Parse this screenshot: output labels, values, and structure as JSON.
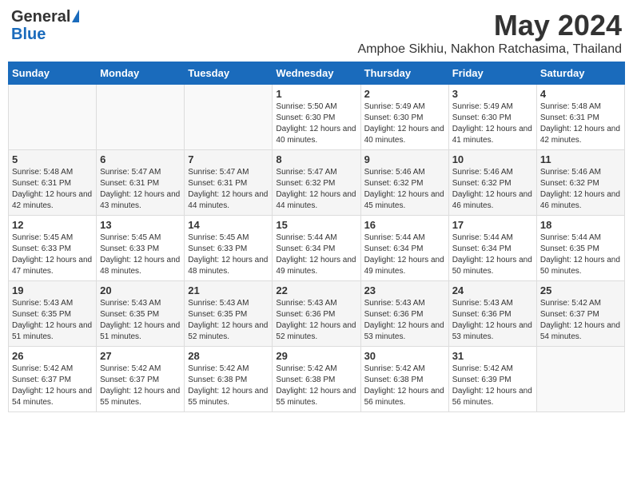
{
  "logo": {
    "general": "General",
    "blue": "Blue"
  },
  "title": "May 2024",
  "subtitle": "Amphoe Sikhiu, Nakhon Ratchasima, Thailand",
  "days_of_week": [
    "Sunday",
    "Monday",
    "Tuesday",
    "Wednesday",
    "Thursday",
    "Friday",
    "Saturday"
  ],
  "weeks": [
    [
      {
        "num": "",
        "info": ""
      },
      {
        "num": "",
        "info": ""
      },
      {
        "num": "",
        "info": ""
      },
      {
        "num": "1",
        "info": "Sunrise: 5:50 AM\nSunset: 6:30 PM\nDaylight: 12 hours and 40 minutes."
      },
      {
        "num": "2",
        "info": "Sunrise: 5:49 AM\nSunset: 6:30 PM\nDaylight: 12 hours and 40 minutes."
      },
      {
        "num": "3",
        "info": "Sunrise: 5:49 AM\nSunset: 6:30 PM\nDaylight: 12 hours and 41 minutes."
      },
      {
        "num": "4",
        "info": "Sunrise: 5:48 AM\nSunset: 6:31 PM\nDaylight: 12 hours and 42 minutes."
      }
    ],
    [
      {
        "num": "5",
        "info": "Sunrise: 5:48 AM\nSunset: 6:31 PM\nDaylight: 12 hours and 42 minutes."
      },
      {
        "num": "6",
        "info": "Sunrise: 5:47 AM\nSunset: 6:31 PM\nDaylight: 12 hours and 43 minutes."
      },
      {
        "num": "7",
        "info": "Sunrise: 5:47 AM\nSunset: 6:31 PM\nDaylight: 12 hours and 44 minutes."
      },
      {
        "num": "8",
        "info": "Sunrise: 5:47 AM\nSunset: 6:32 PM\nDaylight: 12 hours and 44 minutes."
      },
      {
        "num": "9",
        "info": "Sunrise: 5:46 AM\nSunset: 6:32 PM\nDaylight: 12 hours and 45 minutes."
      },
      {
        "num": "10",
        "info": "Sunrise: 5:46 AM\nSunset: 6:32 PM\nDaylight: 12 hours and 46 minutes."
      },
      {
        "num": "11",
        "info": "Sunrise: 5:46 AM\nSunset: 6:32 PM\nDaylight: 12 hours and 46 minutes."
      }
    ],
    [
      {
        "num": "12",
        "info": "Sunrise: 5:45 AM\nSunset: 6:33 PM\nDaylight: 12 hours and 47 minutes."
      },
      {
        "num": "13",
        "info": "Sunrise: 5:45 AM\nSunset: 6:33 PM\nDaylight: 12 hours and 48 minutes."
      },
      {
        "num": "14",
        "info": "Sunrise: 5:45 AM\nSunset: 6:33 PM\nDaylight: 12 hours and 48 minutes."
      },
      {
        "num": "15",
        "info": "Sunrise: 5:44 AM\nSunset: 6:34 PM\nDaylight: 12 hours and 49 minutes."
      },
      {
        "num": "16",
        "info": "Sunrise: 5:44 AM\nSunset: 6:34 PM\nDaylight: 12 hours and 49 minutes."
      },
      {
        "num": "17",
        "info": "Sunrise: 5:44 AM\nSunset: 6:34 PM\nDaylight: 12 hours and 50 minutes."
      },
      {
        "num": "18",
        "info": "Sunrise: 5:44 AM\nSunset: 6:35 PM\nDaylight: 12 hours and 50 minutes."
      }
    ],
    [
      {
        "num": "19",
        "info": "Sunrise: 5:43 AM\nSunset: 6:35 PM\nDaylight: 12 hours and 51 minutes."
      },
      {
        "num": "20",
        "info": "Sunrise: 5:43 AM\nSunset: 6:35 PM\nDaylight: 12 hours and 51 minutes."
      },
      {
        "num": "21",
        "info": "Sunrise: 5:43 AM\nSunset: 6:35 PM\nDaylight: 12 hours and 52 minutes."
      },
      {
        "num": "22",
        "info": "Sunrise: 5:43 AM\nSunset: 6:36 PM\nDaylight: 12 hours and 52 minutes."
      },
      {
        "num": "23",
        "info": "Sunrise: 5:43 AM\nSunset: 6:36 PM\nDaylight: 12 hours and 53 minutes."
      },
      {
        "num": "24",
        "info": "Sunrise: 5:43 AM\nSunset: 6:36 PM\nDaylight: 12 hours and 53 minutes."
      },
      {
        "num": "25",
        "info": "Sunrise: 5:42 AM\nSunset: 6:37 PM\nDaylight: 12 hours and 54 minutes."
      }
    ],
    [
      {
        "num": "26",
        "info": "Sunrise: 5:42 AM\nSunset: 6:37 PM\nDaylight: 12 hours and 54 minutes."
      },
      {
        "num": "27",
        "info": "Sunrise: 5:42 AM\nSunset: 6:37 PM\nDaylight: 12 hours and 55 minutes."
      },
      {
        "num": "28",
        "info": "Sunrise: 5:42 AM\nSunset: 6:38 PM\nDaylight: 12 hours and 55 minutes."
      },
      {
        "num": "29",
        "info": "Sunrise: 5:42 AM\nSunset: 6:38 PM\nDaylight: 12 hours and 55 minutes."
      },
      {
        "num": "30",
        "info": "Sunrise: 5:42 AM\nSunset: 6:38 PM\nDaylight: 12 hours and 56 minutes."
      },
      {
        "num": "31",
        "info": "Sunrise: 5:42 AM\nSunset: 6:39 PM\nDaylight: 12 hours and 56 minutes."
      },
      {
        "num": "",
        "info": ""
      }
    ]
  ]
}
